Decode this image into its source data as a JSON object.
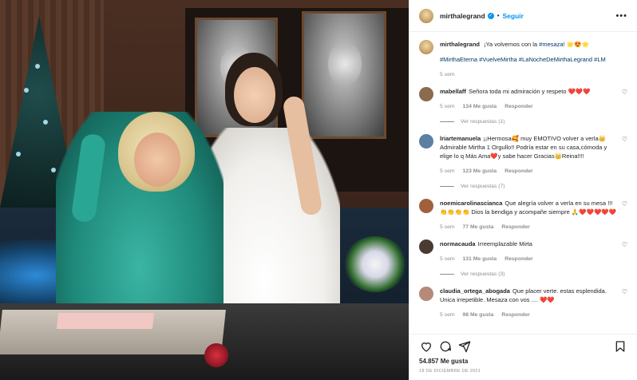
{
  "post": {
    "username": "mirthalegrand",
    "follow_label": "Seguir",
    "dot": "•",
    "more_label": "•••"
  },
  "caption": {
    "username": "mirthalegrand",
    "text_before": "¡Ya volvemos con la ",
    "mention": "#mesaza!",
    "emoji": " 🌟😍🌟",
    "hashtags": "#MirthaEterna #VuelveMirtha #LaNocheDeMirthaLegrand #LM",
    "time": "5 sem"
  },
  "comments": [
    {
      "username": "mabellaff",
      "text": "Señora toda mi admiración y respeto ",
      "emoji": "❤️❤️❤️",
      "time": "5 sem",
      "likes": "134 Me gusta",
      "reply_label": "Responder",
      "view_replies": "Ver respuestas (1)",
      "avatar_color": "#8a6b4c"
    },
    {
      "username": "lriartemanuela",
      "text": "¡¡Hermosa🥰 muy EMOTIVO volver a verla👑 Admirable Mirtha 1 Orgullo!! Podría estar en su casa,cómoda y elige lo q Más Ama❤️y sabe hacer Gracias👑Reina!!!!",
      "emoji": "",
      "time": "5 sem",
      "likes": "123 Me gusta",
      "reply_label": "Responder",
      "view_replies": "Ver respuestas (7)",
      "avatar_color": "#5c7fa3"
    },
    {
      "username": "noemicarolinascianca",
      "text": "Que alegría volver a verla en su mesa !!!👏👏👏👏 Dios la bendiga y acompañe siempre 🙏",
      "emoji": "❤️❤️❤️❤️❤️",
      "time": "5 sem",
      "likes": "77 Me gusta",
      "reply_label": "Responder",
      "view_replies": "",
      "avatar_color": "#a0603c"
    },
    {
      "username": "normacauda",
      "text": "Irreemplazable Mirta",
      "emoji": "",
      "time": "5 sem",
      "likes": "131 Me gusta",
      "reply_label": "Responder",
      "view_replies": "Ver respuestas (3)",
      "avatar_color": "#4a3a32"
    },
    {
      "username": "claudia_ortega_abogada",
      "text": "Que placer verte. estas esplendida. Unica irrepetible. Mesaza con vos .... ",
      "emoji": "❤️❤️",
      "time": "5 sem",
      "likes": "98 Me gusta",
      "reply_label": "Responder",
      "view_replies": "",
      "avatar_color": "#b48a78"
    }
  ],
  "footer": {
    "likes": "54.857 Me gusta",
    "date": "18 DE DICIEMBRE DE 2021"
  },
  "icons": {
    "heart": "heart-icon",
    "comment": "comment-icon",
    "share": "share-icon",
    "save": "bookmark-icon"
  }
}
